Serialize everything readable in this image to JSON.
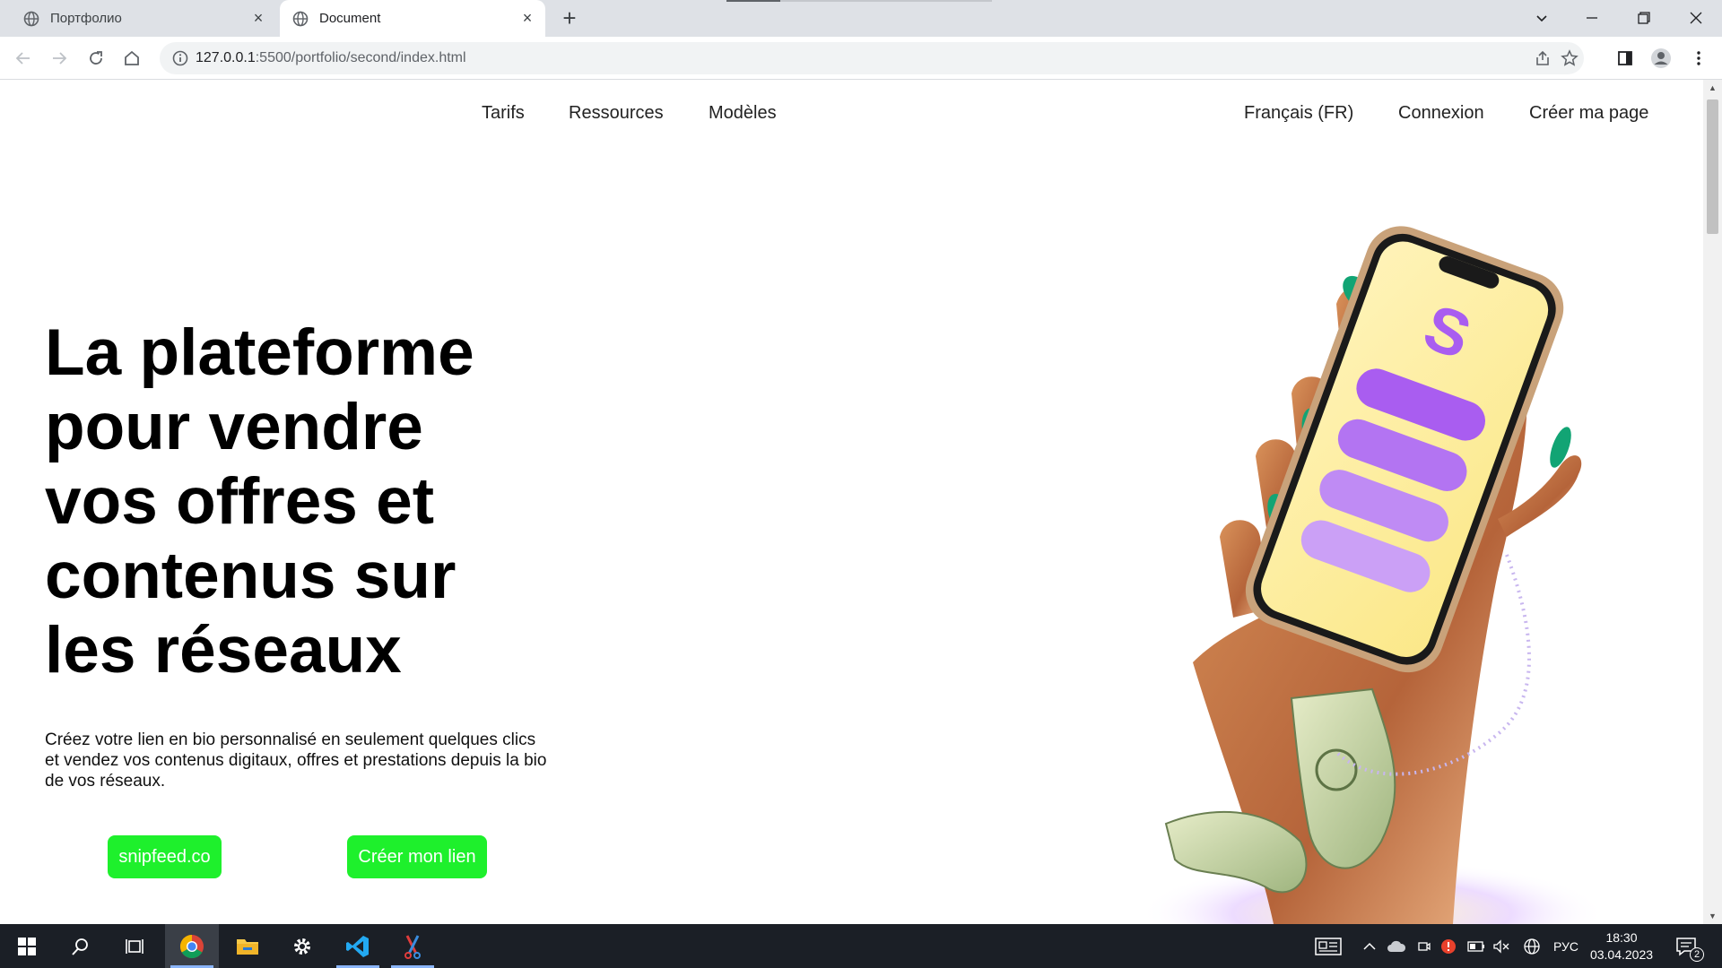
{
  "browser": {
    "tabs": [
      {
        "title": "Портфолио",
        "active": false
      },
      {
        "title": "Document",
        "active": true
      }
    ],
    "address": {
      "host": "127.0.0.1",
      "path": ":5500/portfolio/second/index.html"
    }
  },
  "nav": {
    "left": [
      "Tarifs",
      "Ressources",
      "Modèles"
    ],
    "language": "Français (FR)",
    "login": "Connexion",
    "create_page": "Créer ma page"
  },
  "hero": {
    "title": "La plateforme pour vendre vos offres et contenus sur les réseaux",
    "description": "Créez votre lien en bio personnalisé en seulement quelques clics et vendez vos contenus digitaux, offres et prestations depuis la bio de vos réseaux.",
    "button_primary": "snipfeed.co",
    "button_secondary": "Créer mon lien"
  },
  "colors": {
    "cta": "#1ef02c",
    "phone_screen": "#fbee9a",
    "phone_bars": "#a95df0",
    "nails": "#10a070"
  },
  "taskbar": {
    "tray_language": "РУС",
    "time": "18:30",
    "date": "03.04.2023",
    "notification_count": "2"
  }
}
